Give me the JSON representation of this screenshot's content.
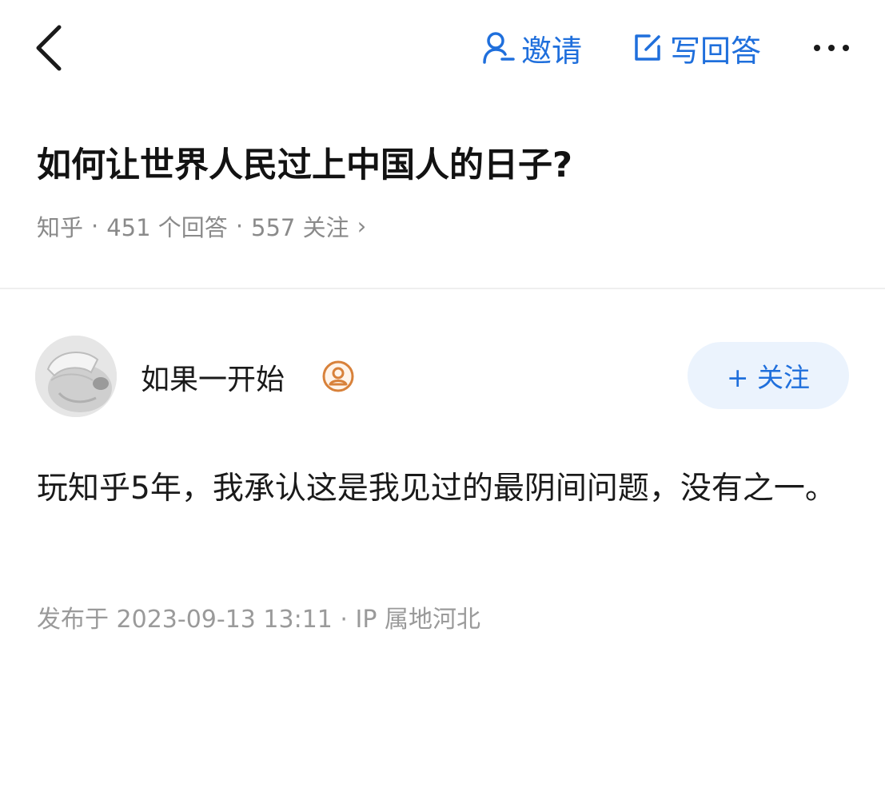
{
  "header": {
    "back_icon": "chevron-left-icon",
    "invite": {
      "icon": "person-add-icon",
      "label": "邀请"
    },
    "write_answer": {
      "icon": "edit-icon",
      "label": "写回答"
    },
    "more_icon": "more-horizontal-icon"
  },
  "question": {
    "title": "如何让世界人民过上中国人的日子?",
    "meta": {
      "source": "知乎",
      "separator": "·",
      "answers": "451 个回答",
      "follows": "557 关注",
      "chevron": "›"
    }
  },
  "answer": {
    "author": {
      "name": "如果一开始",
      "badge_icon": "user-badge-icon",
      "avatar_icon": "avatar-icon"
    },
    "follow_button": "+ 关注",
    "content": "玩知乎5年，我承认这是我见过的最阴间问题，没有之一。",
    "meta": "发布于 2023-09-13 13:11 · IP 属地河北"
  },
  "colors": {
    "accent": "#1f6fdc",
    "follow_bg": "#ebf3fd",
    "meta_text": "#8a8a8a",
    "badge": "#d8813a"
  }
}
